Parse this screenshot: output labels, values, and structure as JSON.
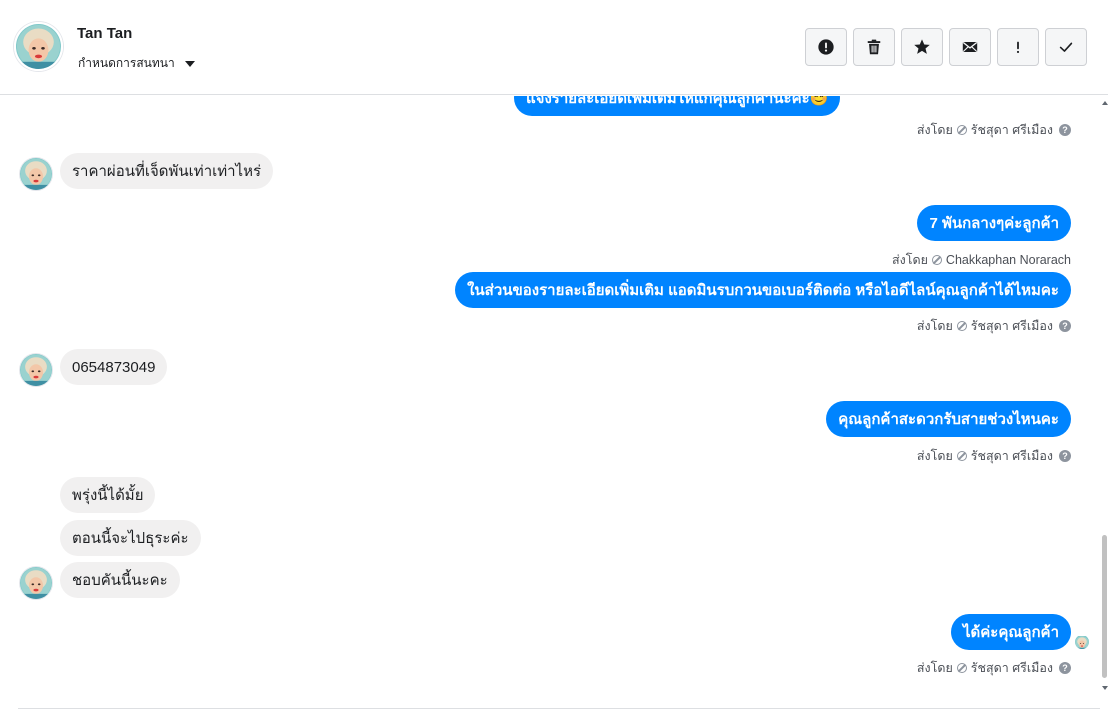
{
  "header": {
    "contact_name": "Tan Tan",
    "conversation_settings_label": "กำหนดการสนทนา",
    "toolbar": {
      "buttons": [
        {
          "icon": "alert-circle-icon",
          "action": "mark-spam"
        },
        {
          "icon": "trash-icon",
          "action": "delete"
        },
        {
          "icon": "star-icon",
          "action": "star"
        },
        {
          "icon": "envelope-icon",
          "action": "mark-unread"
        },
        {
          "icon": "exclamation-icon",
          "action": "follow-up"
        },
        {
          "icon": "checkmark-icon",
          "action": "mark-done"
        }
      ]
    }
  },
  "messages": {
    "m0": {
      "text": "แจ้งรายละเอียดเพิ่มเติมให้แก่คุณลูกค้านะคะ😊"
    },
    "s0": {
      "prefix": "ส่งโดย",
      "agent": "รัชสุดา ศรีเมือง"
    },
    "m1": {
      "text": "ราคาผ่อนที่เจ็ดพันเท่าเท่าไหร่"
    },
    "m2": {
      "text": "7 พันกลางๆค่ะลูกค้า"
    },
    "s2": {
      "prefix": "ส่งโดย",
      "agent": "Chakkaphan Norarach"
    },
    "m3": {
      "text": "ในส่วนของรายละเอียดเพิ่มเติม แอดมินรบกวนขอเบอร์ติดต่อ หรือไอดีไลน์คุณลูกค้าได้ไหมคะ"
    },
    "s3": {
      "prefix": "ส่งโดย",
      "agent": "รัชสุดา ศรีเมือง"
    },
    "m4": {
      "text": "0654873049"
    },
    "m5": {
      "text": "คุณลูกค้าสะดวกรับสายช่วงไหนคะ"
    },
    "s5": {
      "prefix": "ส่งโดย",
      "agent": "รัชสุดา ศรีเมือง"
    },
    "m6": {
      "text": "พรุ่งนี้ได้มั้ย"
    },
    "m7": {
      "text": "ตอนนี้จะไปธุระค่ะ"
    },
    "m8": {
      "text": "ชอบคันนี้นะคะ"
    },
    "m9": {
      "text": "ได้ค่ะคุณลูกค้า"
    },
    "s9": {
      "prefix": "ส่งโดย",
      "agent": "รัชสุดา ศรีเมือง"
    }
  },
  "colors": {
    "outgoing_bubble": "#0084ff",
    "incoming_bubble": "#f1f0f0",
    "meta_text": "#4b4f56"
  }
}
